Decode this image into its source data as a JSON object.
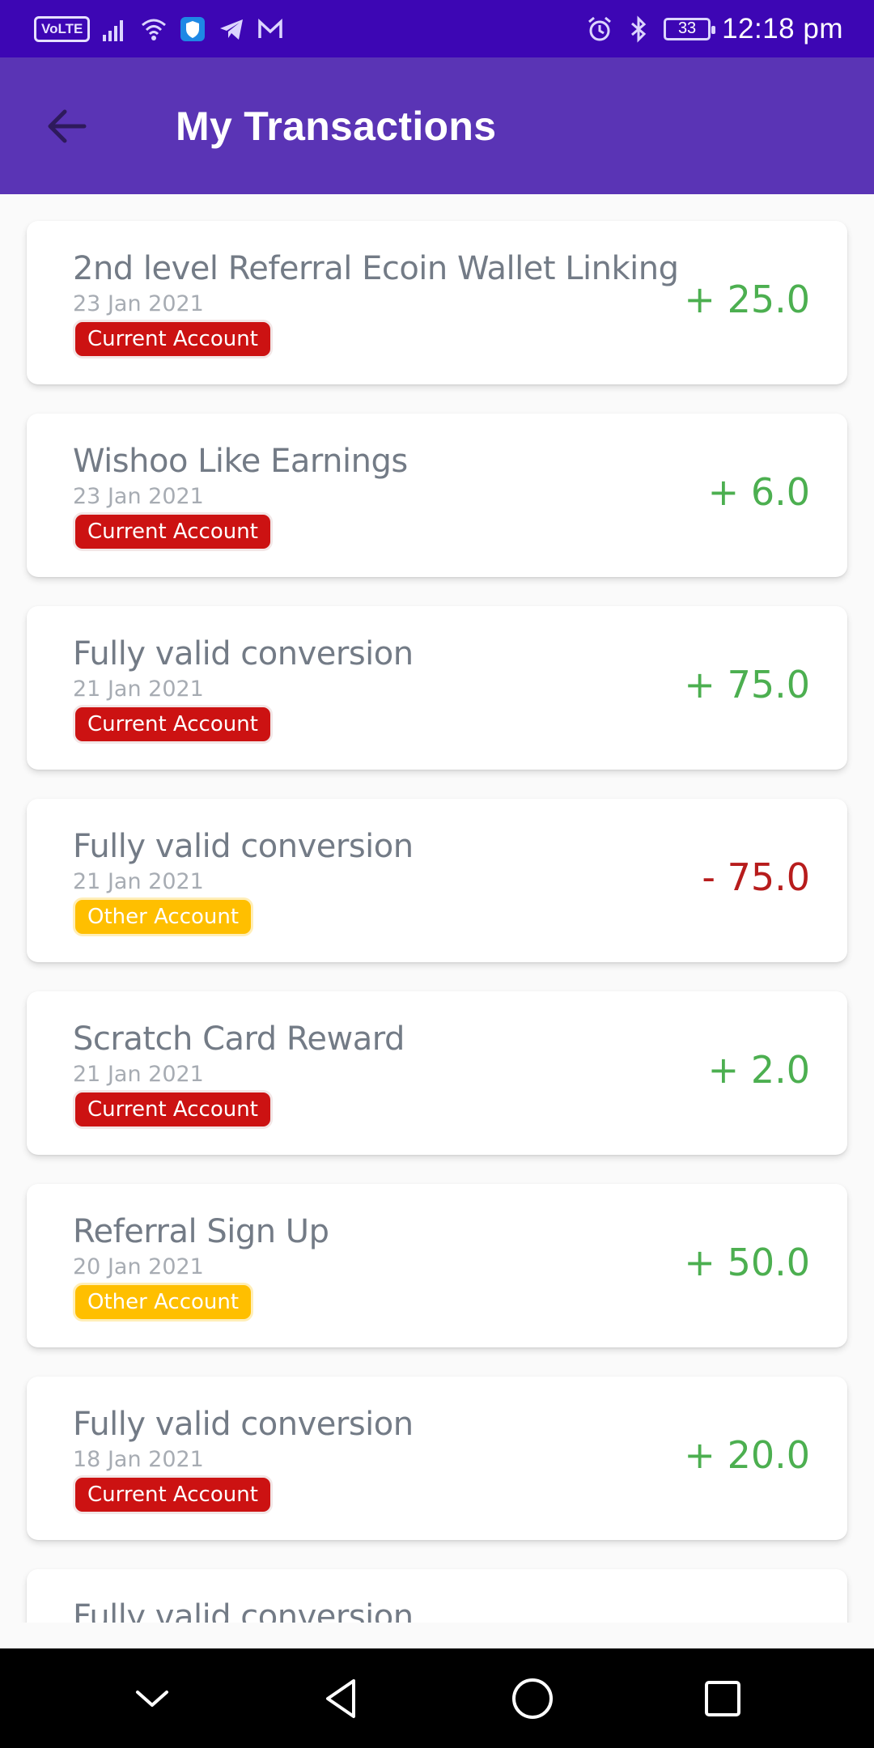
{
  "status_bar": {
    "volte": "VoLTE",
    "battery": "33",
    "time": "12:18 pm"
  },
  "app_bar": {
    "title": "My Transactions"
  },
  "transactions": [
    {
      "title": "2nd level Referral Ecoin Wallet Linking",
      "date": "23 Jan 2021",
      "account": "Current Account",
      "account_type": "current",
      "amount": "+ 25.0",
      "sign": "pos"
    },
    {
      "title": "Wishoo Like Earnings",
      "date": "23 Jan 2021",
      "account": "Current Account",
      "account_type": "current",
      "amount": "+ 6.0",
      "sign": "pos"
    },
    {
      "title": "Fully valid conversion",
      "date": "21 Jan 2021",
      "account": "Current Account",
      "account_type": "current",
      "amount": "+ 75.0",
      "sign": "pos"
    },
    {
      "title": "Fully valid conversion",
      "date": "21 Jan 2021",
      "account": "Other Account",
      "account_type": "other",
      "amount": "- 75.0",
      "sign": "neg"
    },
    {
      "title": "Scratch Card Reward",
      "date": "21 Jan 2021",
      "account": "Current Account",
      "account_type": "current",
      "amount": "+ 2.0",
      "sign": "pos"
    },
    {
      "title": "Referral Sign Up",
      "date": "20 Jan 2021",
      "account": "Other Account",
      "account_type": "other",
      "amount": "+ 50.0",
      "sign": "pos"
    },
    {
      "title": "Fully valid conversion",
      "date": "18 Jan 2021",
      "account": "Current Account",
      "account_type": "current",
      "amount": "+ 20.0",
      "sign": "pos"
    },
    {
      "title": "Fully valid conversion",
      "date": "",
      "account": "",
      "account_type": "",
      "amount": "",
      "sign": ""
    }
  ],
  "colors": {
    "status_bar": "#3d06b4",
    "app_bar": "#5a34b5",
    "positive": "#4caf50",
    "negative": "#b71c1c",
    "current_badge": "#cc1212",
    "other_badge": "#ffbf00"
  },
  "icons": {
    "back": "arrow-left-icon",
    "nav": [
      "chevron-down-icon",
      "nav-back-triangle-icon",
      "home-circle-icon",
      "recents-square-icon"
    ]
  }
}
